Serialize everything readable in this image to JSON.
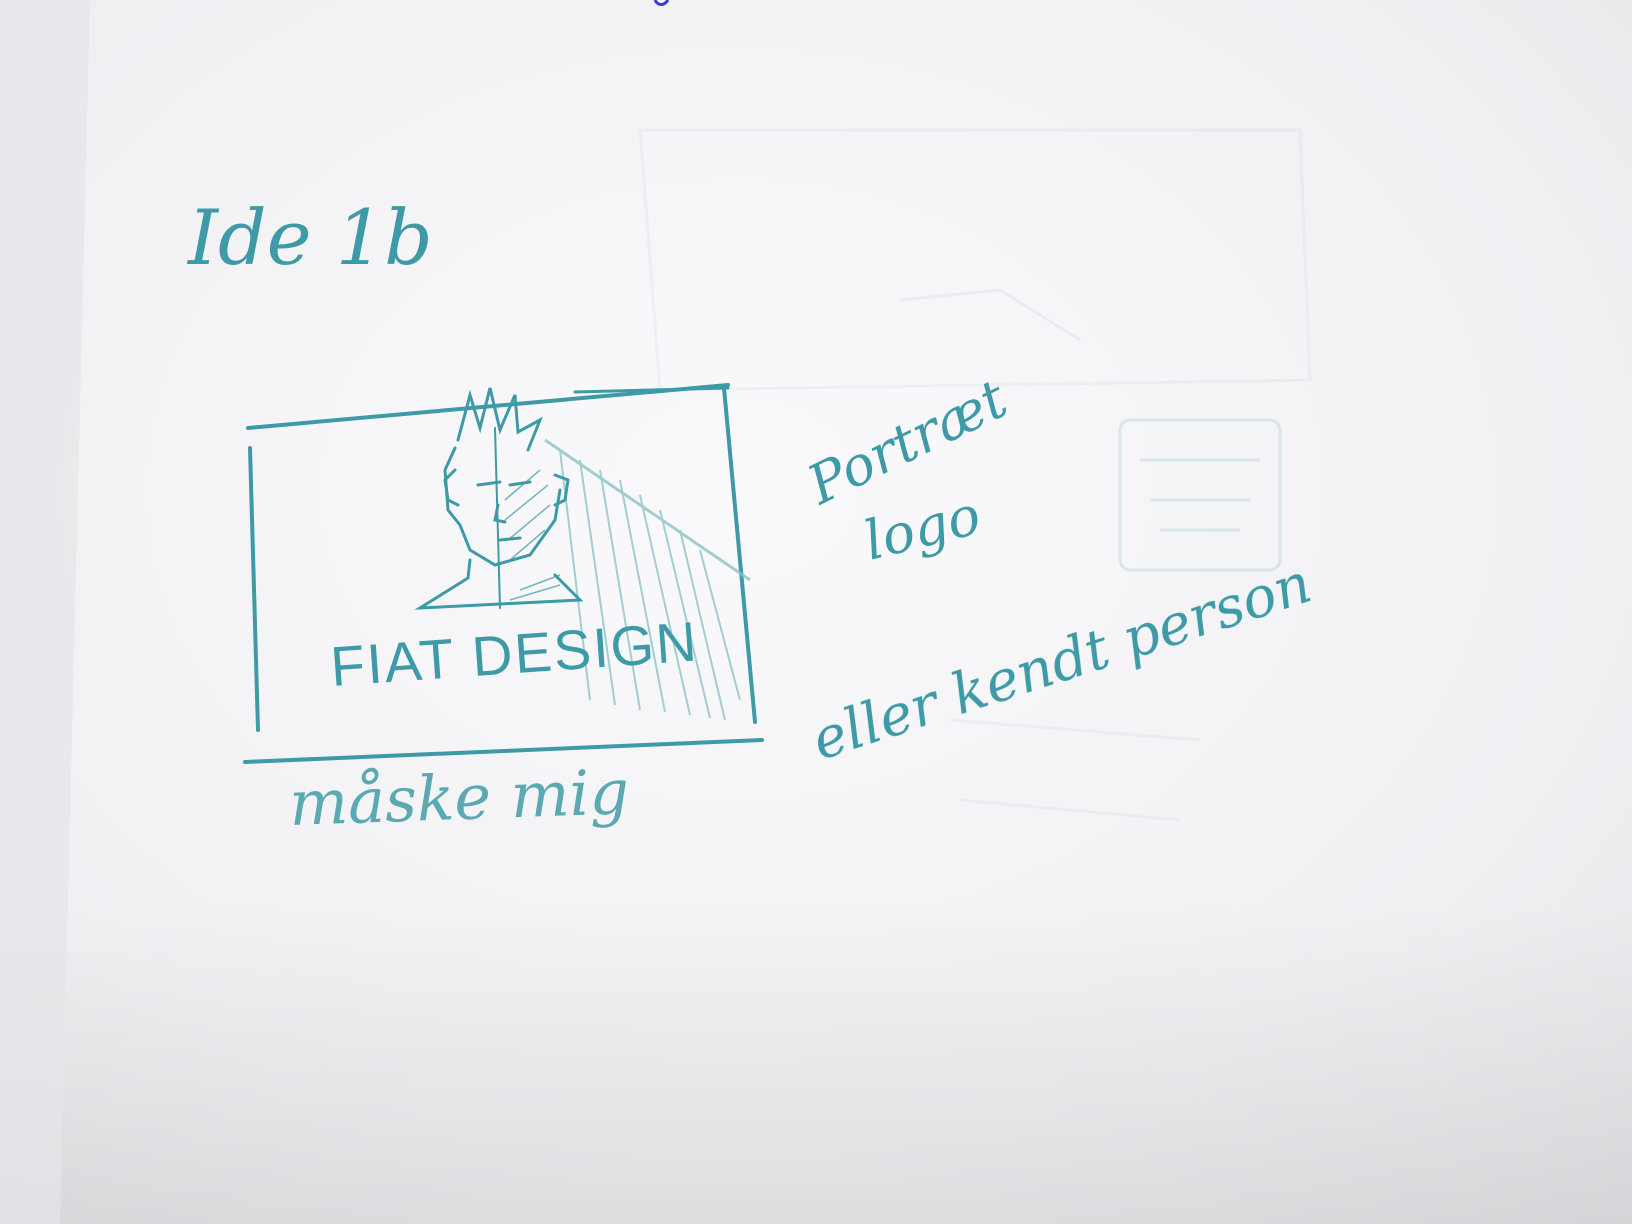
{
  "sketch": {
    "heading": "Ide 1b",
    "frame_text": "FIAT DESIGN",
    "note_portrait": "Portræt",
    "note_logo": "logo",
    "note_maybe_me": "måske mig",
    "note_or_known": "eller kendt person"
  },
  "colors": {
    "ink": "#3d9aa6",
    "ink_light": "#8cc3c8",
    "paper": "#f4f4f6",
    "top_mark": "#3a3ad0"
  }
}
